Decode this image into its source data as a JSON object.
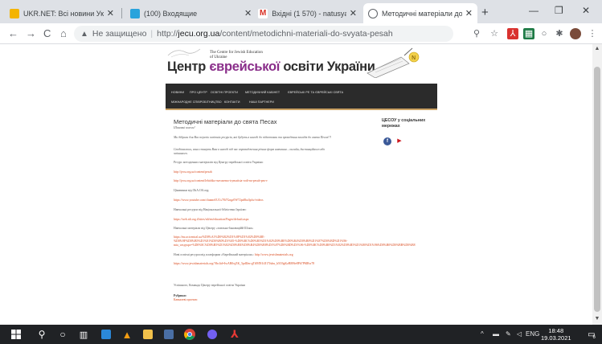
{
  "browser": {
    "tabs": [
      {
        "title": "UKR.NET: Всі новини Україн",
        "icon": "ukrnet-icon",
        "color": "#f4b400",
        "active": false
      },
      {
        "title": "(100) Входящие",
        "icon": "mail-icon",
        "color": "#29a3dc",
        "active": false
      },
      {
        "title": "Вхідні (1 570) - natusya20@",
        "icon": "gmail-icon",
        "color": "#d93025",
        "active": false
      },
      {
        "title": "Методичні матеріали до св",
        "icon": "globe-icon",
        "color": "#5f6368",
        "active": true
      }
    ],
    "new_tab_label": "+",
    "address": {
      "security_label": "Не защищено",
      "protocol": "http://",
      "host": "jecu.org.ua",
      "path": "/content/metodichni-materiali-do-svyata-pesah"
    }
  },
  "site": {
    "logo_subtitle_line1": "The Centre for Jewish Education",
    "logo_subtitle_line2": "of Ukraine",
    "logo_main_prefix": "Центр ",
    "logo_main_accent": "єврейської",
    "logo_main_suffix": " освіти України",
    "menu": [
      "НОВИНИ",
      "ПРО ЦЕНТР",
      "ОСВІТНІ ПРОЕКТИ",
      "МЕТОДИЧНИЙ КАБІНЕТ",
      "ЄВРЕЙСЬКІ РЕ ТА ЄВРЕЙСЬКІ СВЯТА",
      "МІЖНАРОДНЕ СПІВРОБІТНИЦТВО",
      "КОНТАКТИ",
      "НАШІ ПАРТНЕРИ"
    ],
    "article": {
      "title": "Методичні матеріали до свята Песах",
      "greeting": "Шановні колеги!",
      "intro": "Ми дібрали для Вас перелік освітніх ресурсів, які будуть в нагоді до підготовки та проведення заходів до свята Песах!!!",
      "note": "Сподіваємось, вони стануть Вам в нагоді під час впровадження різних форм навчання – онлайн, дистанційного або змішаного.",
      "resources_heading": "Ресурс методичних матеріалів від Центру єврейської освіти України:",
      "link1": "http://jecu.org.ua/content/pesah",
      "link2": "http://jecu.org.ua/content/lehtchko-navazemo-trymatisia-rodi-na-pesah-pm-v",
      "video_heading": "Цікавинки від ОkА.ОА.org:",
      "link3": "https://www.youtube.com/channel/UCs78i7Gngr0W72pz8ba3pfw/videos",
      "library_heading": "Навчальні ресурси від Національної бібліотеки Ізраїлю:",
      "link4": "https://web.nli.org.il/sites/nli/en/education/Pages/default.aspx",
      "center_heading": "Навчальні матеріали від Центру «ємельно-Інноваційй Шлях»",
      "link5a": "https://mr.actcentral.ua/%D0%A1%D0%B2%D1%8F%D1%82%D0%BE-",
      "link5b": "%D0%9F%D0%B5%D1%81%D0%B0%D1%85-%D0%BC%D0%B5%D1%82%D0%BE%D0%B4%D0%B8%D1%87%D0%BD%D1%96-",
      "link5c": "mia_vasypsps=%D0%9C%D0%B5%D1%82%D0%BE%D0%B4%D0%B8%D1%87%D0%BD%D1%96-%D0%BC%D0%B0%D1%82%D0%B5%D1%80%D1%96%D0%B0%D0%BB%D0%B8",
      "platform_heading": "Нові освітні ресурси від платформи «Єврейський матеріали»:",
      "link6_inline": "http://www.jewishmaterials.org",
      "link7": "https://www.jewishmaterials.org/?fbclid=IwAR0xjZK_5pdIJm-gTffMN1iIJ17Jubu_b5O3gKzBB9fe8Ph7PMRw78",
      "signoff": "Успішного, Команда Центру єврейської освіти України",
      "category_label": "Рубрики:",
      "category_value": "Кавказеві проекти"
    },
    "sidebar": {
      "title": "ЦЕСОУ у соціальних мережах",
      "facebook_color": "#3b5998",
      "youtube_color": "#cc181e"
    }
  },
  "taskbar": {
    "language": "ENG",
    "time": "18:48",
    "date": "19.03.2021",
    "notification_count": "6"
  }
}
